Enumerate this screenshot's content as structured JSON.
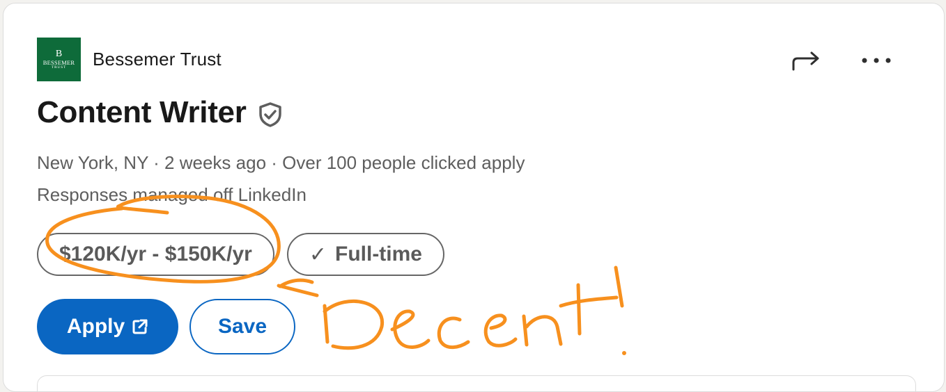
{
  "company": {
    "name": "Bessemer Trust",
    "logo": {
      "monogram": "B",
      "wordmark": "BESSEMER",
      "subtext": "TRUST",
      "color": "#0e6b3a"
    }
  },
  "header_actions": {
    "share_icon": "share-arrow-icon",
    "more_icon": "more-options-icon"
  },
  "job": {
    "title": "Content Writer",
    "verified_icon": "verified-shield-icon",
    "meta_line": "New York, NY · 2 weeks ago · Over 100 people clicked apply",
    "responses_line": "Responses managed off LinkedIn"
  },
  "pills": {
    "salary": "$120K/yr - $150K/yr",
    "job_type": "Full-time",
    "job_type_icon": "check-icon"
  },
  "buttons": {
    "apply": "Apply",
    "apply_icon": "external-link-icon",
    "save": "Save"
  },
  "annotation": {
    "handwritten_note": "Decent!",
    "color": "#f7901e"
  },
  "colors": {
    "primary": "#0a66c2",
    "text": "#191919",
    "secondary_text": "#5e5e5e"
  }
}
